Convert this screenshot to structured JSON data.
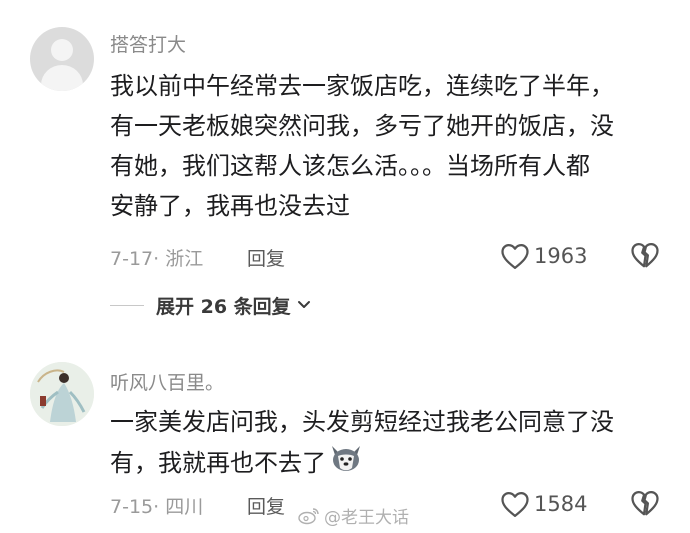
{
  "comments": [
    {
      "username": "搭答打大",
      "content_lines": [
        "我以前中午经常去一家饭店吃，连续吃了半年，",
        "有一天老板娘突然问我，多亏了她开的饭店，没",
        "有她，我们这帮人该怎么活。。。当场所有人都",
        "安静了，我再也没去过"
      ],
      "date_location": "7-17· 浙江",
      "reply_label": "回复",
      "like_count": "1963",
      "expand_replies_label": "展开 26 条回复"
    },
    {
      "username": "听风八百里。",
      "content_lines": [
        "一家美发店问我，头发剪短经过我老公同意了没",
        "有，我就再也不去了"
      ],
      "date_location": "7-15· 四川",
      "reply_label": "回复",
      "like_count": "1584"
    }
  ],
  "watermark": {
    "text": "@老王大话"
  },
  "icons": {
    "like": "heart-outline-icon",
    "dislike": "broken-heart-icon",
    "expand": "chevron-down-icon",
    "emoji": "husky-dog-emoji-icon",
    "watermark_logo": "weibo-logo-icon"
  },
  "colors": {
    "text_primary": "#1d1d1f",
    "text_secondary": "#8a8a8a",
    "text_meta": "#9a9a9a"
  }
}
